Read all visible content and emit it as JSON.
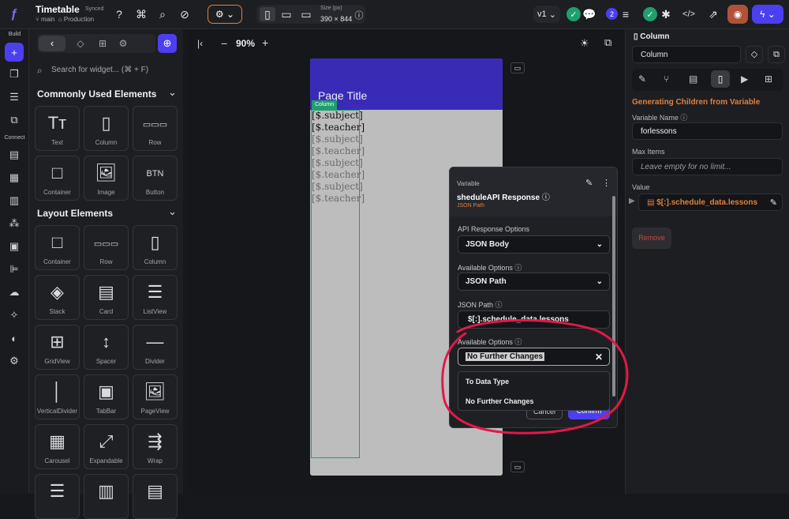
{
  "topbar": {
    "project_name": "Timetable",
    "sync_status": "Synced",
    "branch": "main",
    "environment": "Production",
    "size_label": "Size (px)",
    "size_value": "390 × 844",
    "version": "v1",
    "badge_count": "2"
  },
  "rail": {
    "build_label": "Build",
    "connect_label": "Connect"
  },
  "panel": {
    "search_placeholder": "Search for widget... (⌘ + F)",
    "common_title": "Commonly Used Elements",
    "layout_title": "Layout Elements",
    "common": [
      {
        "icon": "Tт",
        "label": "Text"
      },
      {
        "icon": "▯",
        "label": "Column"
      },
      {
        "icon": "▭▭▭",
        "label": "Row"
      },
      {
        "icon": "□",
        "label": "Container"
      },
      {
        "icon": "🖼",
        "label": "Image"
      },
      {
        "icon": "BTN",
        "label": "Button"
      }
    ],
    "layout": [
      {
        "icon": "□",
        "label": "Container"
      },
      {
        "icon": "▭▭▭",
        "label": "Row"
      },
      {
        "icon": "▯",
        "label": "Column"
      },
      {
        "icon": "◈",
        "label": "Stack"
      },
      {
        "icon": "▤",
        "label": "Card"
      },
      {
        "icon": "☰",
        "label": "ListView"
      },
      {
        "icon": "⊞",
        "label": "GridView"
      },
      {
        "icon": "↕",
        "label": "Spacer"
      },
      {
        "icon": "—",
        "label": "Divider"
      },
      {
        "icon": "│",
        "label": "VerticalDivider"
      },
      {
        "icon": "▣",
        "label": "TabBar"
      },
      {
        "icon": "🖼",
        "label": "PageView"
      },
      {
        "icon": "▦",
        "label": "Carousel"
      },
      {
        "icon": "⤢",
        "label": "Expandable"
      },
      {
        "icon": "⇶",
        "label": "Wrap"
      },
      {
        "icon": "☰",
        "label": ""
      },
      {
        "icon": "▥",
        "label": ""
      },
      {
        "icon": "▤",
        "label": ""
      }
    ]
  },
  "canvas": {
    "zoom": "90%",
    "page_title": "Page Title",
    "column_tag": "Column",
    "items": [
      "[$.subject]",
      "[$.teacher]",
      "[$.subject]",
      "[$.teacher]",
      "[$.subject]",
      "[$.teacher]",
      "[$.subject]",
      "[$.teacher]"
    ]
  },
  "rpanel": {
    "header": "Column",
    "name_value": "Column",
    "section_title": "Generating Children from Variable",
    "variable_name_label": "Variable Name",
    "variable_name_value": "forlessons",
    "max_items_label": "Max Items",
    "max_items_placeholder": "Leave empty for no limit...",
    "value_label": "Value",
    "value_text": "$[:].schedule_data.lessons",
    "remove_label": "Remove"
  },
  "popup": {
    "variable_label": "Variable",
    "variable_title": "sheduleAPI Response",
    "variable_sub": "JSON Path",
    "api_options_label": "API Response Options",
    "api_options_value": "JSON Body",
    "available_label": "Available Options",
    "available_value": "JSON Path",
    "json_path_label": "JSON Path",
    "json_path_value": "$[:].schedule_data.lessons",
    "available2_label": "Available Options",
    "available2_value": "No Further Changes",
    "dropdown_options": [
      "To Data Type",
      "No Further Changes"
    ],
    "cancel_label": "Cancel",
    "confirm_label": "Confirm"
  },
  "colors": {
    "accent": "#4b3ff0",
    "appbar": "#3a2bb6",
    "orange": "#e0803c",
    "annotation": "#e0194a",
    "green": "#1f9e6e"
  }
}
